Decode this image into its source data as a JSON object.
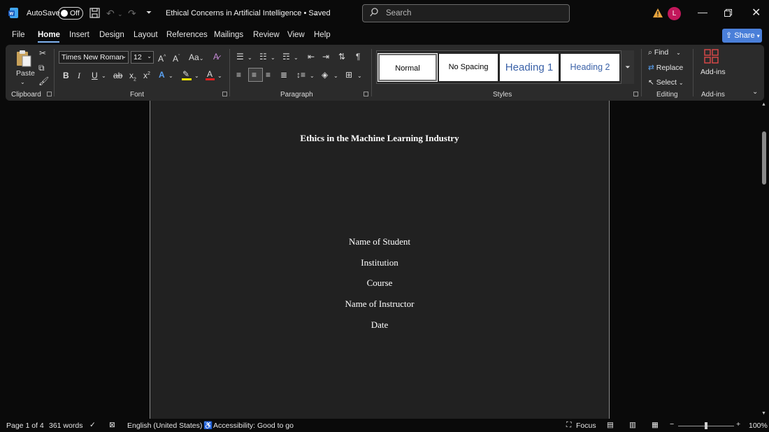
{
  "titlebar": {
    "autosave_label": "AutoSave",
    "autosave_state": "Off",
    "doc_title": "Ethical Concerns in Artificial Intelligence • Saved",
    "search_placeholder": "Search",
    "avatar_initial": "L"
  },
  "tabs": [
    "File",
    "Home",
    "Insert",
    "Design",
    "Layout",
    "References",
    "Mailings",
    "Review",
    "View",
    "Help"
  ],
  "share_label": "Share",
  "ribbon": {
    "clipboard": {
      "paste_label": "Paste",
      "group_label": "Clipboard"
    },
    "font": {
      "font_name": "Times New Roman",
      "font_size": "12",
      "group_label": "Font"
    },
    "paragraph": {
      "group_label": "Paragraph"
    },
    "styles": {
      "group_label": "Styles",
      "items": [
        "Normal",
        "No Spacing",
        "Heading 1",
        "Heading 2"
      ]
    },
    "editing": {
      "find": "Find",
      "replace": "Replace",
      "select": "Select",
      "group_label": "Editing"
    },
    "addins": {
      "label": "Add-ins",
      "group_label": "Add-ins"
    }
  },
  "document": {
    "title": "Ethics in the Machine Learning Industry",
    "lines": [
      "Name of Student",
      "Institution",
      "Course",
      "Name of Instructor",
      "Date"
    ]
  },
  "status": {
    "page": "Page 1 of 4",
    "words": "361 words",
    "language": "English (United States)",
    "accessibility": "Accessibility: Good to go",
    "focus": "Focus",
    "zoom": "100%"
  },
  "colors": {
    "accent": "#4a7fd9",
    "avatar": "#c2185b",
    "page_bg": "#212121",
    "ribbon_bg": "#2b2b2b"
  }
}
